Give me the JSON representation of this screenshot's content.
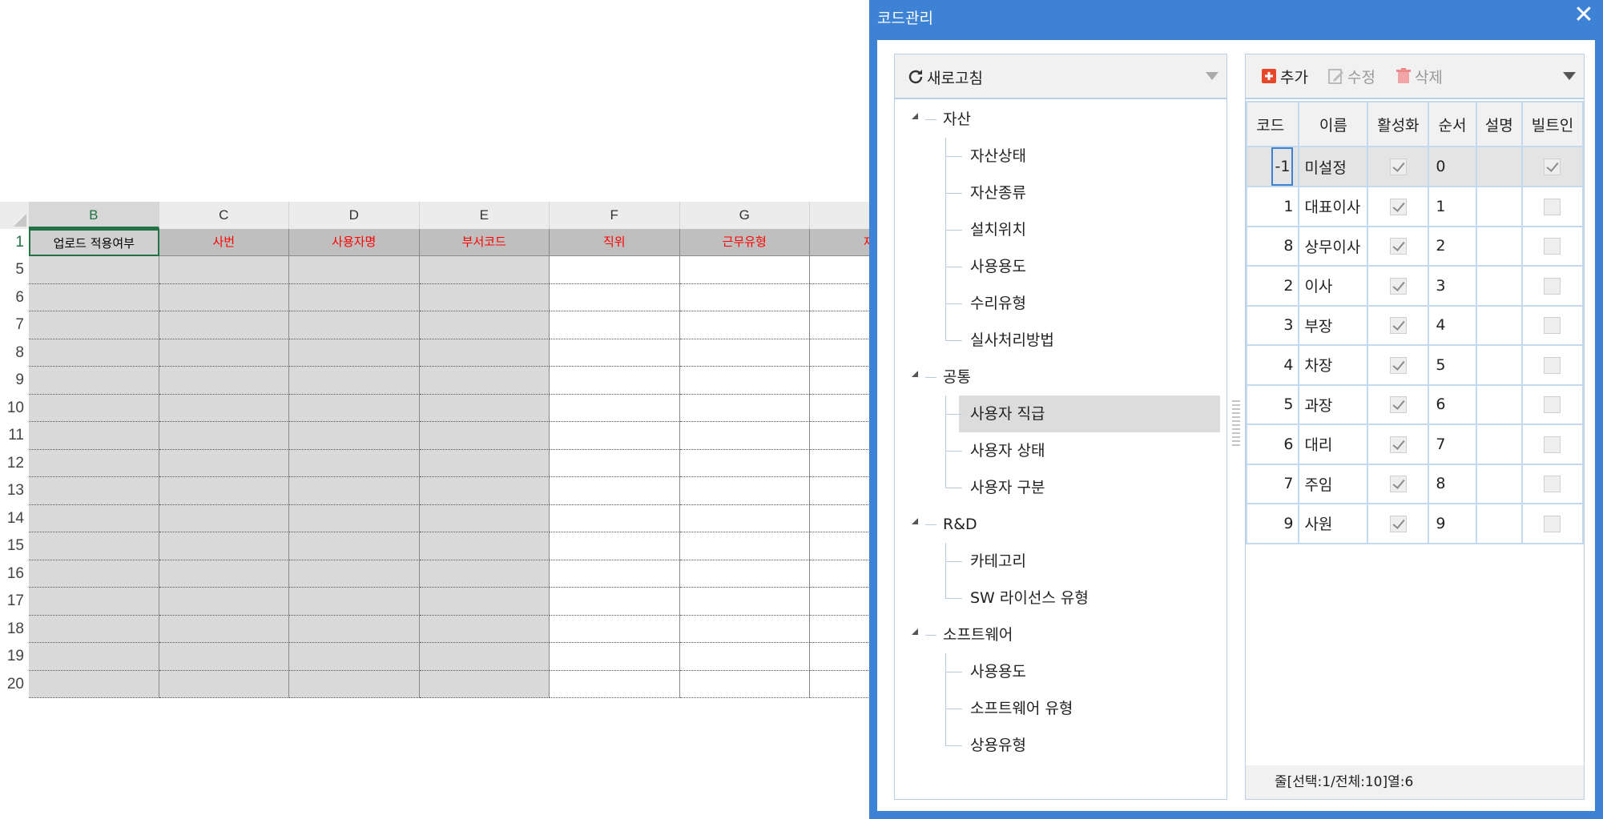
{
  "sheet": {
    "columns": [
      "B",
      "C",
      "D",
      "E",
      "F",
      "G",
      ""
    ],
    "active_column": "B",
    "header_row_number": "1",
    "header_cells": [
      "업로드 적용여부",
      "사번",
      "사용자명",
      "부서코드",
      "직위",
      "근무유형",
      "재직"
    ],
    "row_numbers": [
      "5",
      "6",
      "7",
      "8",
      "9",
      "10",
      "11",
      "12",
      "13",
      "14",
      "15",
      "16",
      "17",
      "18",
      "19",
      "20"
    ],
    "colors": {
      "accent": "#217346",
      "header_text": "#ff0000",
      "gray_cell": "#d9d9d9"
    }
  },
  "dialog": {
    "title": "코드관리",
    "close_icon": "close-icon",
    "colors": {
      "title_bar": "#3d82d4",
      "selected_row": "#e4e4e4"
    },
    "tree_toolbar": {
      "refresh_label": "새로고침"
    },
    "tree": [
      {
        "label": "자산",
        "children": [
          "자산상태",
          "자산종류",
          "설치위치",
          "사용용도",
          "수리유형",
          "실사처리방법"
        ]
      },
      {
        "label": "공통",
        "children": [
          "사용자 직급",
          "사용자 상태",
          "사용자 구분"
        ]
      },
      {
        "label": "R&D",
        "children": [
          "카테고리",
          "SW 라이선스 유형"
        ]
      },
      {
        "label": "소프트웨어",
        "children": [
          "사용용도",
          "소프트웨어 유형",
          "상용유형"
        ]
      }
    ],
    "selected_tree_item": "사용자 직급",
    "grid_toolbar": {
      "add_label": "추가",
      "edit_label": "수정",
      "delete_label": "삭제"
    },
    "grid": {
      "headers": [
        "코드",
        "이름",
        "활성화",
        "순서",
        "설명",
        "빌트인"
      ],
      "rows": [
        {
          "code": "-1",
          "name": "미설정",
          "active": true,
          "order": "0",
          "desc": "",
          "builtin": true
        },
        {
          "code": "1",
          "name": "대표이사",
          "active": true,
          "order": "1",
          "desc": "",
          "builtin": false
        },
        {
          "code": "8",
          "name": "상무이사",
          "active": true,
          "order": "2",
          "desc": "",
          "builtin": false
        },
        {
          "code": "2",
          "name": "이사",
          "active": true,
          "order": "3",
          "desc": "",
          "builtin": false
        },
        {
          "code": "3",
          "name": "부장",
          "active": true,
          "order": "4",
          "desc": "",
          "builtin": false
        },
        {
          "code": "4",
          "name": "차장",
          "active": true,
          "order": "5",
          "desc": "",
          "builtin": false
        },
        {
          "code": "5",
          "name": "과장",
          "active": true,
          "order": "6",
          "desc": "",
          "builtin": false
        },
        {
          "code": "6",
          "name": "대리",
          "active": true,
          "order": "7",
          "desc": "",
          "builtin": false
        },
        {
          "code": "7",
          "name": "주임",
          "active": true,
          "order": "8",
          "desc": "",
          "builtin": false
        },
        {
          "code": "9",
          "name": "사원",
          "active": true,
          "order": "9",
          "desc": "",
          "builtin": false
        }
      ]
    },
    "status": "줄[선택:1/전체:10]열:6"
  }
}
